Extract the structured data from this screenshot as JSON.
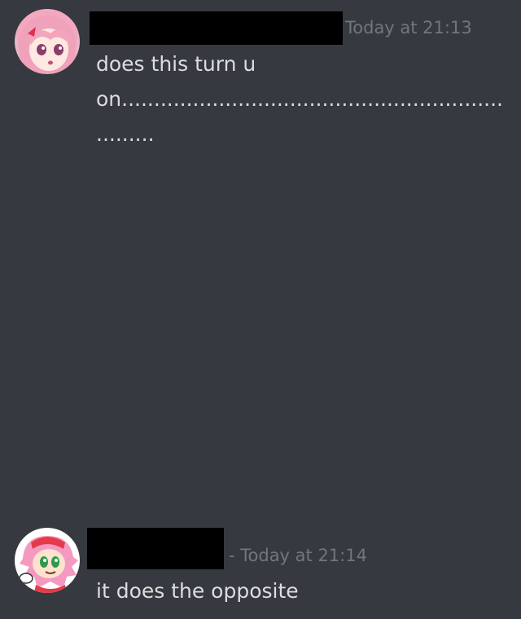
{
  "messages": [
    {
      "avatar_icon": "anime-girl-pink-hair-avatar",
      "username_redacted": true,
      "timestamp": "Today at 21:13",
      "lines": [
        "does this turn u",
        "on.......................................................................",
        "........."
      ]
    },
    {
      "avatar_icon": "pink-hedgehog-avatar",
      "username_redacted": true,
      "timestamp": "- Today at 21:14",
      "lines": [
        "it does the opposite"
      ]
    }
  ],
  "colors": {
    "background": "#36393f",
    "message_text": "#dcddde",
    "timestamp_text": "#72767d",
    "redaction": "#000000"
  }
}
